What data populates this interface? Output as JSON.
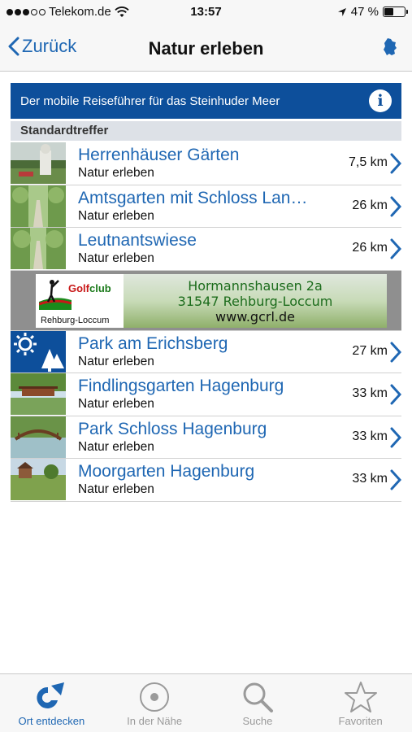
{
  "status_bar": {
    "carrier": "Telekom.de",
    "time": "13:57",
    "battery_percent": "47 %",
    "battery_level": 0.47
  },
  "nav": {
    "back_label": "Zurück",
    "title": "Natur erleben",
    "right_icon": "region-map-icon"
  },
  "banner": {
    "text": "Der mobile Reiseführer für das Steinhuder Meer",
    "info_label": "i"
  },
  "section": {
    "title": "Standardtreffer"
  },
  "results": [
    {
      "title": "Herrenhäuser Gärten",
      "subtitle": "Natur erleben",
      "distance": "7,5 km",
      "thumb": "garden-statue-photo"
    },
    {
      "title": "Amtsgarten mit Schloss Lan…",
      "subtitle": "Natur erleben",
      "distance": "26 km",
      "thumb": "tree-alley-photo"
    },
    {
      "title": "Leutnantswiese",
      "subtitle": "Natur erleben",
      "distance": "26 km",
      "thumb": "tree-alley-photo"
    }
  ],
  "ad": {
    "logo_golf": "Golf",
    "logo_club": "club",
    "logo_place": "Rehburg-Loccum",
    "line1": "Hormannshausen 2a",
    "line2": "31547 Rehburg-Loccum",
    "line3": "www.gcrl.de"
  },
  "results2": [
    {
      "title": "Park am Erichsberg",
      "subtitle": "Natur erleben",
      "distance": "27 km",
      "thumb": "sun-trees-icon"
    },
    {
      "title": "Findlingsgarten Hagenburg",
      "subtitle": "Natur erleben",
      "distance": "33 km",
      "thumb": "pond-bridge-photo"
    },
    {
      "title": "Park Schloss Hagenburg",
      "subtitle": "Natur erleben",
      "distance": "33 km",
      "thumb": "pond-bridge-photo"
    },
    {
      "title": "Moorgarten Hagenburg",
      "subtitle": "Natur erleben",
      "distance": "33 km",
      "thumb": "meadow-house-photo"
    }
  ],
  "tabs": [
    {
      "label": "Ort entdecken",
      "icon": "discover-icon",
      "active": true
    },
    {
      "label": "In der Nähe",
      "icon": "nearby-icon",
      "active": false
    },
    {
      "label": "Suche",
      "icon": "search-icon",
      "active": false
    },
    {
      "label": "Favoriten",
      "icon": "star-icon",
      "active": false
    }
  ],
  "colors": {
    "accent": "#1f67b3",
    "banner": "#0d4f9b",
    "section_header": "#dde1e7"
  }
}
